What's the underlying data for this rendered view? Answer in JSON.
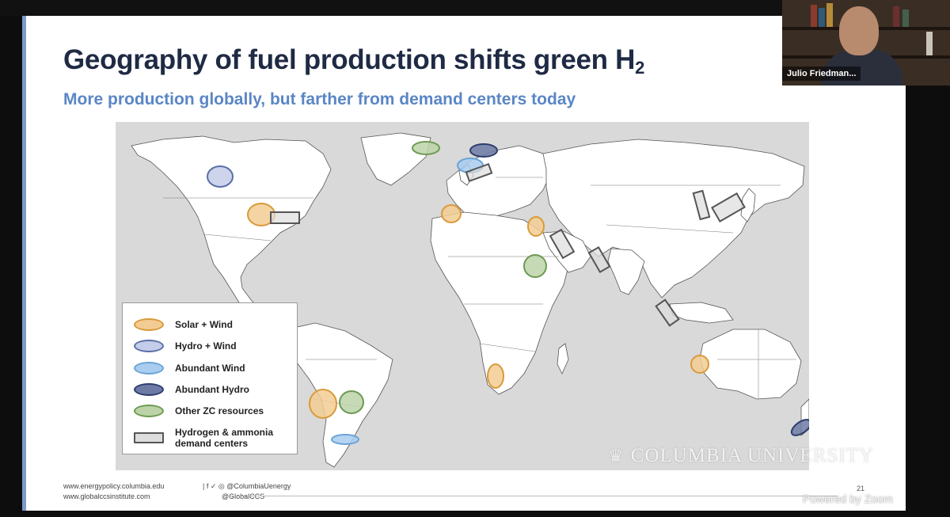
{
  "slide": {
    "title_main": "Geography of fuel production shifts green H",
    "title_sub": "2",
    "subtitle": "More production globally, but farther from demand centers today",
    "page_number": "21"
  },
  "legend": {
    "items": [
      {
        "label": "Solar + Wind",
        "shape": "ellipse",
        "stroke": "#d99a3a",
        "fill": "#f2cc93"
      },
      {
        "label": "Hydro + Wind",
        "shape": "ellipse",
        "stroke": "#5b6fa8",
        "fill": "#c4cde9"
      },
      {
        "label": "Abundant Wind",
        "shape": "ellipse",
        "stroke": "#6aa4d8",
        "fill": "#a9cdee"
      },
      {
        "label": "Abundant Hydro",
        "shape": "ellipse",
        "stroke": "#2e3d6e",
        "fill": "#6d7aa6"
      },
      {
        "label": "Other ZC resources",
        "shape": "ellipse",
        "stroke": "#6d9a52",
        "fill": "#bcd3a8"
      },
      {
        "label": "Hydrogen & ammonia\ndemand centers",
        "shape": "rect",
        "stroke": "#555555",
        "fill": "#dddddd"
      }
    ]
  },
  "footer": {
    "web1": "www.energypolicy.columbia.edu",
    "social_icons": "| f ✓ ◎",
    "handle1": "@ColumbiaUenergy",
    "web2": "www.globalccsinstitute.com",
    "handle2": "@GlobalCCS"
  },
  "branding": {
    "watermark": "COLUMBIA UNIVERSITY",
    "powered_by": "Powered by Zoom"
  },
  "video": {
    "participant_name": "Julio Friedman..."
  },
  "colors": {
    "title": "#1f2a44",
    "subtitle": "#5a86c5",
    "map_ocean": "#d9d9d9",
    "land": "#ffffff"
  }
}
